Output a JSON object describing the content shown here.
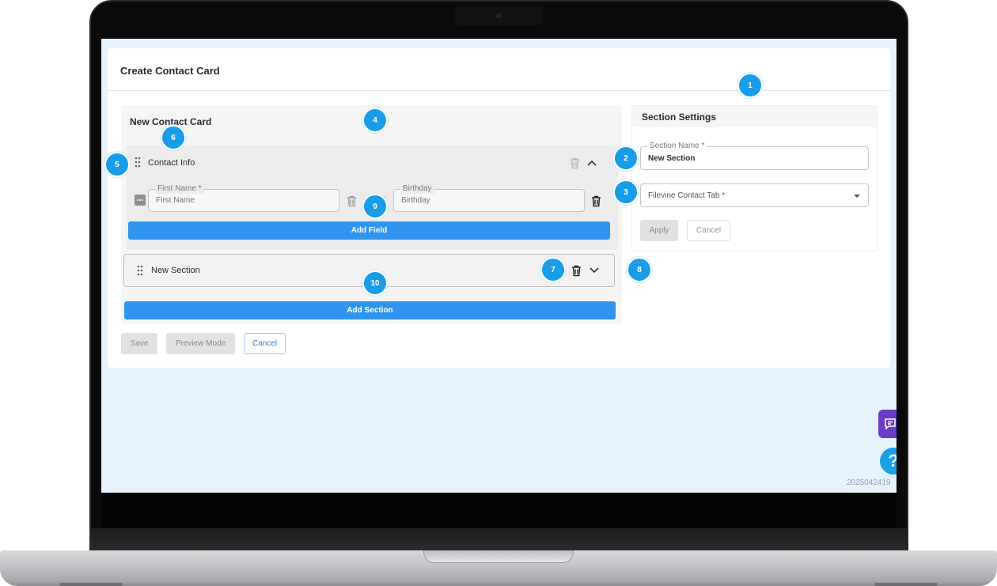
{
  "page": {
    "title": "Create Contact Card",
    "build_id": "2025042419"
  },
  "editor": {
    "title": "New Contact Card",
    "sections": [
      {
        "label": "Contact Info",
        "expanded": true,
        "fields": [
          {
            "legend": "First Name *",
            "placeholder": "First Name"
          },
          {
            "legend": "Birthday",
            "placeholder": "Birthday"
          }
        ],
        "add_field_label": "Add Field"
      },
      {
        "label": "New Section",
        "expanded": false
      }
    ],
    "add_section_label": "Add Section"
  },
  "actions": {
    "save_label": "Save",
    "preview_label": "Preview Mode",
    "cancel_label": "Cancel"
  },
  "settings": {
    "title": "Section Settings",
    "section_name_legend": "Section Name *",
    "section_name_value": "New Section",
    "tab_select_label": "Filevine Contact Tab *",
    "apply_label": "Apply",
    "cancel_label": "Cancel"
  },
  "help": {
    "label": "?"
  },
  "markers": [
    "1",
    "2",
    "3",
    "4",
    "5",
    "6",
    "7",
    "8",
    "9",
    "10"
  ],
  "colors": {
    "primary": "#2f95ef",
    "marker": "#1a9de8",
    "chat": "#6a3cc6",
    "screen_bg": "#e5f1fb"
  },
  "icons": [
    "drag-handle-icon",
    "trash-icon",
    "chevron-up-icon",
    "chevron-down-icon",
    "caret-down-icon",
    "chat-icon",
    "help-icon",
    "more-icon"
  ]
}
